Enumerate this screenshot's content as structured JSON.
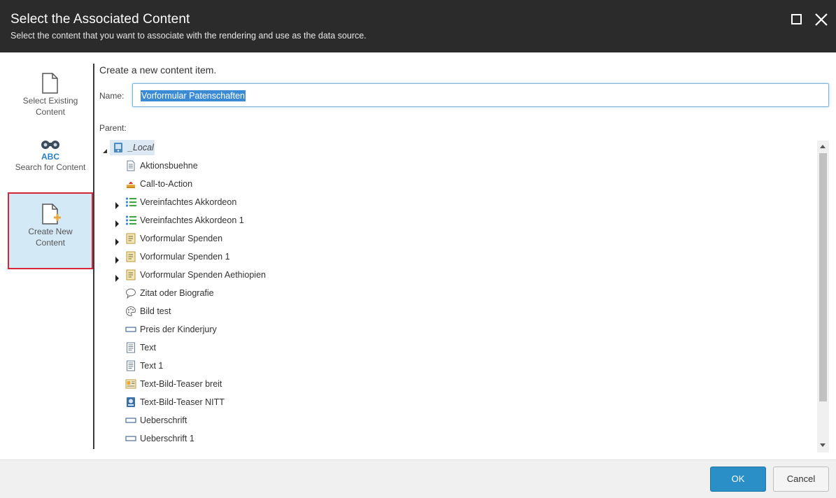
{
  "dialog": {
    "title": "Select the Associated Content",
    "subtitle": "Select the content that you want to associate with the rendering and use as the data source."
  },
  "sidebar": {
    "items": [
      {
        "label": "Select Existing Content",
        "icon": "document-icon",
        "active": false
      },
      {
        "label": "Search for Content",
        "icon": "binoculars-abc-icon",
        "active": false
      },
      {
        "label": "Create New Content",
        "icon": "new-document-icon",
        "active": true
      }
    ]
  },
  "form": {
    "heading": "Create a new content item.",
    "name_label": "Name:",
    "name_value": "Vorformular Patenschaften",
    "parent_label": "Parent:"
  },
  "tree": {
    "root": {
      "label": "_Local",
      "icon": "local-folder-icon",
      "expanded": true,
      "selected": true
    },
    "children": [
      {
        "label": "Aktionsbuehne",
        "icon": "page-icon",
        "expandable": false
      },
      {
        "label": "Call-to-Action",
        "icon": "call-to-action-icon",
        "expandable": false
      },
      {
        "label": "Vereinfachtes Akkordeon",
        "icon": "list-icon",
        "expandable": true
      },
      {
        "label": "Vereinfachtes Akkordeon 1",
        "icon": "list-icon",
        "expandable": true
      },
      {
        "label": "Vorformular Spenden",
        "icon": "form-icon",
        "expandable": true
      },
      {
        "label": "Vorformular Spenden 1",
        "icon": "form-icon",
        "expandable": true
      },
      {
        "label": "Vorformular Spenden Aethiopien",
        "icon": "form-icon",
        "expandable": true
      },
      {
        "label": "Zitat oder Biografie",
        "icon": "speech-bubble-icon",
        "expandable": false
      },
      {
        "label": "Bild test",
        "icon": "palette-icon",
        "expandable": false
      },
      {
        "label": "Preis der Kinderjury",
        "icon": "field-icon",
        "expandable": false
      },
      {
        "label": "Text",
        "icon": "text-document-icon",
        "expandable": false
      },
      {
        "label": "Text 1",
        "icon": "text-document-icon",
        "expandable": false
      },
      {
        "label": "Text-Bild-Teaser breit",
        "icon": "teaser-icon",
        "expandable": false
      },
      {
        "label": "Text-Bild-Teaser NITT",
        "icon": "image-card-icon",
        "expandable": false
      },
      {
        "label": "Ueberschrift",
        "icon": "field-icon",
        "expandable": false
      },
      {
        "label": "Ueberschrift 1",
        "icon": "field-icon",
        "expandable": false
      }
    ]
  },
  "footer": {
    "ok_label": "OK",
    "cancel_label": "Cancel"
  },
  "colors": {
    "header_bg": "#2b2b2b",
    "accent": "#2b8fc7",
    "active_item_bg": "#d3e9f6",
    "active_item_border": "#d7263a",
    "selection": "#3b8ad6"
  }
}
